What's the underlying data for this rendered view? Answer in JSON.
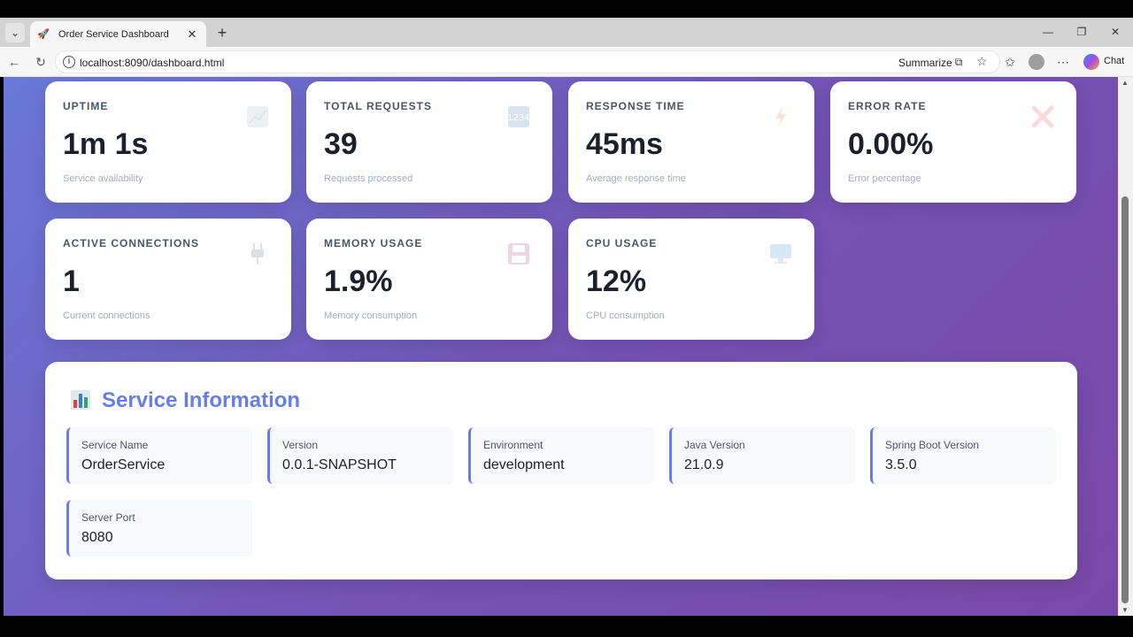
{
  "browser": {
    "tab_title": "Order Service Dashboard",
    "url": "localhost:8090/dashboard.html",
    "summarize_label": "Summarize",
    "chat_label": "Chat"
  },
  "metrics": [
    {
      "label": "UPTIME",
      "value": "1m 1s",
      "sub": "Service availability",
      "icon": "chart-up-icon"
    },
    {
      "label": "TOTAL REQUESTS",
      "value": "39",
      "sub": "Requests processed",
      "icon": "numbers-icon"
    },
    {
      "label": "RESPONSE TIME",
      "value": "45ms",
      "sub": "Average response time",
      "icon": "lightning-icon"
    },
    {
      "label": "ERROR RATE",
      "value": "0.00%",
      "sub": "Error percentage",
      "icon": "cross-icon"
    },
    {
      "label": "ACTIVE CONNECTIONS",
      "value": "1",
      "sub": "Current connections",
      "icon": "plug-icon"
    },
    {
      "label": "MEMORY USAGE",
      "value": "1.9%",
      "sub": "Memory consumption",
      "icon": "floppy-disk-icon"
    },
    {
      "label": "CPU USAGE",
      "value": "12%",
      "sub": "CPU consumption",
      "icon": "monitor-icon"
    }
  ],
  "service_info": {
    "title": "Service Information",
    "items": [
      {
        "label": "Service Name",
        "value": "OrderService"
      },
      {
        "label": "Version",
        "value": "0.0.1-SNAPSHOT"
      },
      {
        "label": "Environment",
        "value": "development"
      },
      {
        "label": "Java Version",
        "value": "21.0.9"
      },
      {
        "label": "Spring Boot Version",
        "value": "3.5.0"
      },
      {
        "label": "Server Port",
        "value": "8080"
      }
    ]
  },
  "colors": {
    "accent": "#667eea",
    "gradient_start": "#6a78d8",
    "gradient_end": "#7a48a8"
  }
}
